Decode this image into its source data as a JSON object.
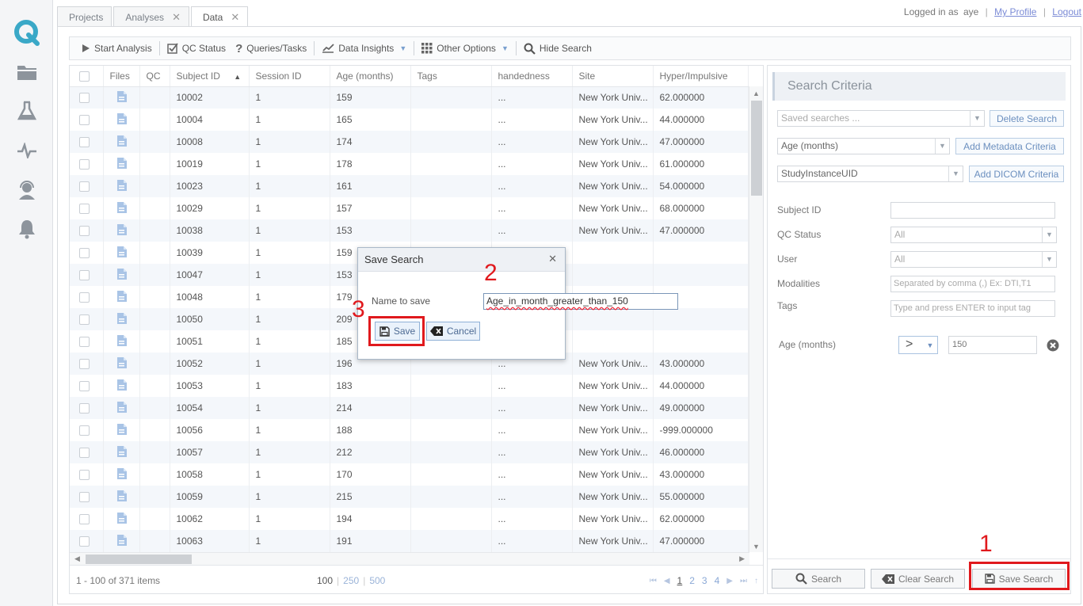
{
  "tabs": [
    {
      "label": "Projects",
      "closable": false,
      "active": false
    },
    {
      "label": "Analyses",
      "closable": true,
      "active": false
    },
    {
      "label": "Data",
      "closable": true,
      "active": true
    }
  ],
  "user": {
    "logged_in_prefix": "Logged in as",
    "username": "aye",
    "profile_link": "My Profile",
    "logout_link": "Logout"
  },
  "sidebar": {
    "items": [
      "logo-icon",
      "folder-icon",
      "flask-icon",
      "activity-icon",
      "support-icon",
      "bell-icon"
    ]
  },
  "toolbar": {
    "start_analysis": "Start Analysis",
    "qc_status": "QC Status",
    "queries_tasks": "Queries/Tasks",
    "data_insights": "Data Insights",
    "other_options": "Other Options",
    "hide_search": "Hide Search"
  },
  "grid": {
    "columns": [
      "Files",
      "QC",
      "Subject ID",
      "Session ID",
      "Age (months)",
      "Tags",
      "handedness",
      "Site",
      "Hyper/Impulsive"
    ],
    "rows": [
      [
        "10002",
        "1",
        "159",
        "...",
        "New York Univ...",
        "62.000000"
      ],
      [
        "10004",
        "1",
        "165",
        "...",
        "New York Univ...",
        "44.000000"
      ],
      [
        "10008",
        "1",
        "174",
        "...",
        "New York Univ...",
        "47.000000"
      ],
      [
        "10019",
        "1",
        "178",
        "...",
        "New York Univ...",
        "61.000000"
      ],
      [
        "10023",
        "1",
        "161",
        "...",
        "New York Univ...",
        "54.000000"
      ],
      [
        "10029",
        "1",
        "157",
        "...",
        "New York Univ...",
        "68.000000"
      ],
      [
        "10038",
        "1",
        "153",
        "...",
        "New York Univ...",
        "47.000000"
      ],
      [
        "10039",
        "1",
        "159",
        "",
        "",
        ""
      ],
      [
        "10047",
        "1",
        "153",
        "",
        "",
        ""
      ],
      [
        "10048",
        "1",
        "179",
        "",
        "",
        ""
      ],
      [
        "10050",
        "1",
        "209",
        "",
        "",
        ""
      ],
      [
        "10051",
        "1",
        "185",
        "",
        "",
        ""
      ],
      [
        "10052",
        "1",
        "196",
        "...",
        "New York Univ...",
        "43.000000"
      ],
      [
        "10053",
        "1",
        "183",
        "...",
        "New York Univ...",
        "44.000000"
      ],
      [
        "10054",
        "1",
        "214",
        "...",
        "New York Univ...",
        "49.000000"
      ],
      [
        "10056",
        "1",
        "188",
        "...",
        "New York Univ...",
        "-999.000000"
      ],
      [
        "10057",
        "1",
        "212",
        "...",
        "New York Univ...",
        "46.000000"
      ],
      [
        "10058",
        "1",
        "170",
        "...",
        "New York Univ...",
        "43.000000"
      ],
      [
        "10059",
        "1",
        "215",
        "...",
        "New York Univ...",
        "55.000000"
      ],
      [
        "10062",
        "1",
        "194",
        "...",
        "New York Univ...",
        "62.000000"
      ],
      [
        "10063",
        "1",
        "191",
        "...",
        "New York Univ...",
        "47.000000"
      ]
    ],
    "pager": {
      "info": "1 - 100 of 371 items",
      "page_sizes": [
        "100",
        "250",
        "500"
      ],
      "pages": [
        "1",
        "2",
        "3",
        "4"
      ]
    }
  },
  "search": {
    "title": "Search Criteria",
    "saved_searches_placeholder": "Saved searches ...",
    "delete_search": "Delete Search",
    "metadata_select": "Age (months)",
    "add_metadata": "Add Metadata Criteria",
    "dicom_select": "StudyInstanceUID",
    "add_dicom": "Add DICOM Criteria",
    "fields": {
      "subject_id_label": "Subject ID",
      "qc_status_label": "QC Status",
      "qc_status_value": "All",
      "user_label": "User",
      "user_value": "All",
      "modalities_label": "Modalities",
      "modalities_placeholder": "Separated by comma (,) Ex: DTI,T1",
      "tags_label": "Tags",
      "tags_placeholder": "Type and press ENTER to input tag"
    },
    "criteria": {
      "label": "Age (months)",
      "operator": ">",
      "value": "150"
    },
    "buttons": {
      "search": "Search",
      "clear": "Clear Search",
      "save": "Save Search"
    }
  },
  "dialog": {
    "title": "Save Search",
    "name_label": "Name to save",
    "name_value": "Age_in_month_greater_than_150",
    "save": "Save",
    "cancel": "Cancel"
  },
  "annotations": {
    "one": "1",
    "two": "2",
    "three": "3"
  },
  "colors": {
    "annotation_red": "#e0191d",
    "logo_teal": "#3aa8c7",
    "link_blue": "#7b8bd6"
  }
}
